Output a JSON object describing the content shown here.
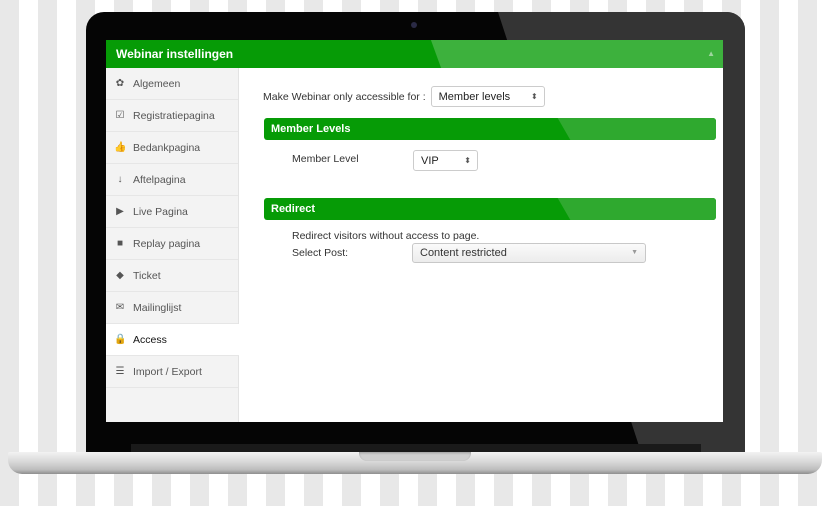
{
  "window": {
    "title": "Webinar instellingen",
    "collapse_icon": "caret-up-icon"
  },
  "sidebar": {
    "items": [
      {
        "label": "Algemeen",
        "icon": "gear-icon",
        "glyph": "✿",
        "active": false
      },
      {
        "label": "Registratiepagina",
        "icon": "check-square-icon",
        "glyph": "☑",
        "active": false
      },
      {
        "label": "Bedankpagina",
        "icon": "thumbs-up-icon",
        "glyph": "👍",
        "active": false
      },
      {
        "label": "Aftelpagina",
        "icon": "sort-numeric-icon",
        "glyph": "↓",
        "active": false
      },
      {
        "label": "Live Pagina",
        "icon": "play-icon",
        "glyph": "▶",
        "active": false
      },
      {
        "label": "Replay pagina",
        "icon": "video-camera-icon",
        "glyph": "■",
        "active": false
      },
      {
        "label": "Ticket",
        "icon": "tags-icon",
        "glyph": "◆",
        "active": false
      },
      {
        "label": "Mailinglijst",
        "icon": "envelope-icon",
        "glyph": "✉",
        "active": false
      },
      {
        "label": "Access",
        "icon": "lock-icon",
        "glyph": "🔒",
        "active": true
      },
      {
        "label": "Import / Export",
        "icon": "list-icon",
        "glyph": "☰",
        "active": false
      }
    ]
  },
  "main": {
    "access_label": "Make Webinar only accessible for :",
    "access_select": {
      "value": "Member levels",
      "arrows": "⬍"
    },
    "member_levels": {
      "heading": "Member Levels",
      "field_label": "Member Level",
      "select": {
        "value": "VIP",
        "arrows": "⬍"
      }
    },
    "redirect": {
      "heading": "Redirect",
      "description": "Redirect visitors without access to page.",
      "field_label": "Select Post:",
      "select": {
        "value": "Content restricted",
        "arrow": "▼"
      }
    }
  },
  "colors": {
    "accent": "#069b06",
    "accent_light": "#3db13d",
    "sidebar_bg": "#f3f3f3"
  }
}
